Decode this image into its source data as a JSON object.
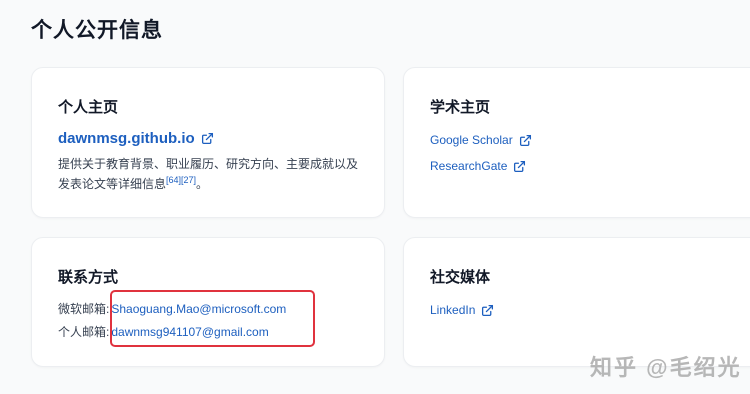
{
  "page_title": "个人公开信息",
  "homepage_card": {
    "title": "个人主页",
    "link": "dawnmsg.github.io",
    "description": "提供关于教育背景、职业履历、研究方向、主要成就以及发表论文等详细信息",
    "citation": "[64][27]",
    "description_end": "。"
  },
  "academic_card": {
    "title": "学术主页",
    "links": [
      "Google Scholar",
      "ResearchGate"
    ]
  },
  "contact_card": {
    "title": "联系方式",
    "rows": [
      {
        "label": "微软邮箱:",
        "email": "Shaoguang.Mao@microsoft.com"
      },
      {
        "label": "个人邮箱:",
        "email": "dawnmsg941107@gmail.com"
      }
    ]
  },
  "social_card": {
    "title": "社交媒体",
    "links": [
      "LinkedIn"
    ]
  },
  "watermark": "知乎 @毛绍光",
  "colors": {
    "link": "#1d5fbf",
    "highlight": "#e0323e",
    "background": "#f9fafb"
  },
  "icons": {
    "external_link": "external-link-icon"
  }
}
